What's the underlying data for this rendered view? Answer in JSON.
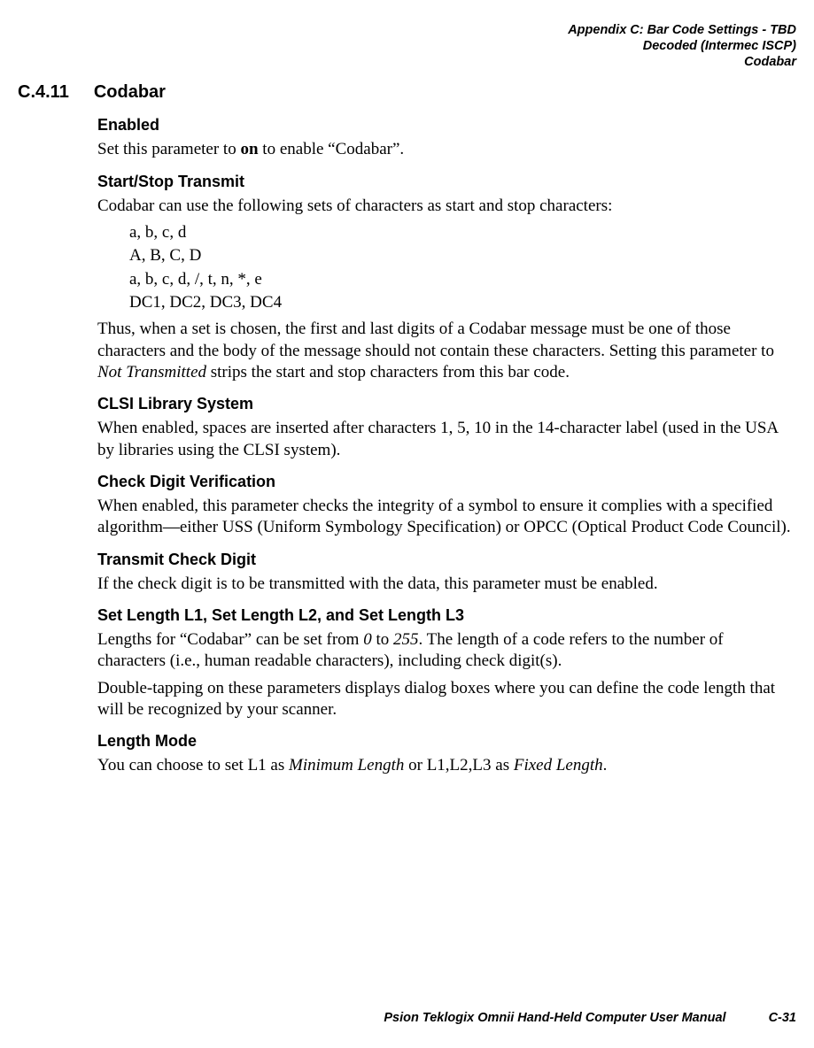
{
  "header": {
    "line1": "Appendix C: Bar Code Settings - TBD",
    "line2": "Decoded (Intermec ISCP)",
    "line3": "Codabar"
  },
  "section": {
    "number": "C.4.11",
    "title": "Codabar"
  },
  "sub": {
    "enabled": {
      "h": "Enabled",
      "p_before": "Set this parameter to ",
      "bold": "on",
      "p_after": " to enable “Codabar”."
    },
    "startstop": {
      "h": "Start/Stop Transmit",
      "intro": "Codabar can use the following sets of characters as start and stop characters:",
      "set1": "a, b, c, d",
      "set2": "A, B, C, D",
      "set3": "a, b, c, d, /, t, n, *, e",
      "set4": "DC1, DC2, DC3, DC4",
      "p_before": "Thus, when a set is chosen, the first and last digits of a Codabar message must be one of those characters and the body of the message should not contain these characters. Setting this parameter to ",
      "ital": "Not Transmitted",
      "p_after": " strips the start and stop characters from this bar code."
    },
    "clsi": {
      "h": "CLSI Library System",
      "p": "When enabled, spaces are inserted after characters 1, 5, 10 in the 14-character label (used in the USA by libraries using the CLSI system)."
    },
    "cdv": {
      "h": "Check Digit Verification",
      "p": "When enabled, this parameter checks the integrity of a symbol to ensure it complies with a specified algorithm—either USS (Uniform Symbology Specification) or OPCC (Optical Product Code Council)."
    },
    "tcd": {
      "h": "Transmit Check Digit",
      "p": "If the check digit is to be transmitted with the data, this parameter must be enabled."
    },
    "len": {
      "h": "Set Length L1, Set Length L2, and Set Length L3",
      "p1_a": "Lengths for “Codabar” can be set from ",
      "ital0": "0",
      "p1_b": " to ",
      "ital255": "255",
      "p1_c": ". The length of a code refers to the number of characters (i.e., human readable characters), including check digit(s).",
      "p2": "Double-tapping on these parameters displays dialog boxes where you can define the code length that will be recognized by your scanner."
    },
    "lm": {
      "h": "Length Mode",
      "p_a": "You can choose to set L1 as ",
      "ital1": "Minimum Length",
      "p_b": " or L1,L2,L3 as ",
      "ital2": "Fixed Length",
      "p_c": "."
    }
  },
  "footer": {
    "book": "Psion Teklogix Omnii Hand-Held Computer User Manual",
    "page": "C-31"
  }
}
